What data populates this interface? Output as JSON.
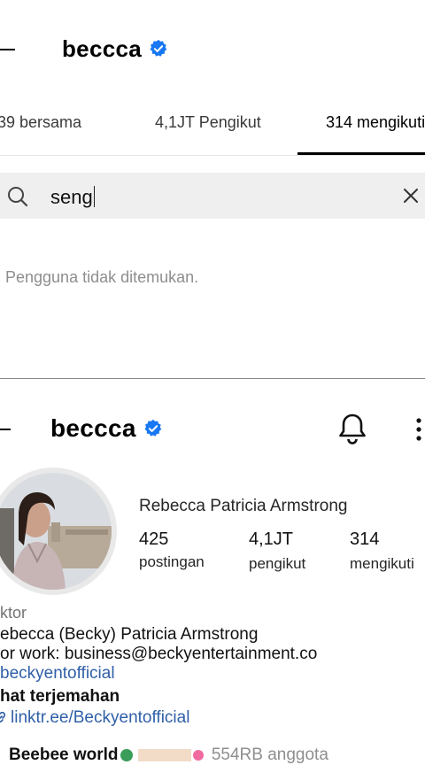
{
  "top": {
    "username": "beccca",
    "tabs": [
      "39 bersama",
      "4,1JT Pengikut",
      "314 mengikuti"
    ],
    "search": {
      "value": "seng"
    },
    "empty_message": "Pengguna tidak ditemukan."
  },
  "profile": {
    "username": "beccca",
    "full_name": "Rebecca Patricia Armstrong",
    "stats": [
      {
        "value": "425",
        "label": "postingan"
      },
      {
        "value": "4,1JT",
        "label": "pengikut"
      },
      {
        "value": "314",
        "label": "mengikuti"
      }
    ],
    "category": "ktor",
    "bio_name": "ebecca (Becky) Patricia Armstrong",
    "bio_work": "or work: business@beckyentertainment.co",
    "bio_handle": "beckyentofficial",
    "see_translation": "hat terjemahan",
    "link": "linktr.ee/Beckyentofficial",
    "channel": "Beebee world",
    "channel_members": "554RB anggota"
  },
  "colors": {
    "verified": "#1877f2",
    "link": "#2f5fa8",
    "search_bg": "#efefef",
    "muted": "#8e8e8e"
  }
}
